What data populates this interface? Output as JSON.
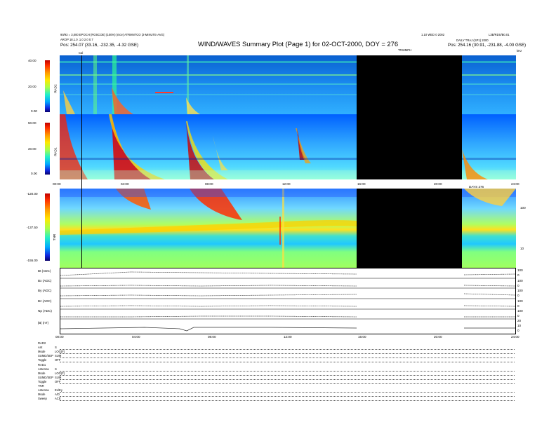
{
  "header": {
    "left_line1": "90/93 = 3,000 EPOCH (ROSCOE) (100%) (nice) ATRMNTCO (2-MINUTE-AVG)",
    "left_line2": "AROP 18.1.0 .1.0 2.0 0.7",
    "left_line3": "Pos:   254.07 (33.16, -232.35, -4.32 GSE)",
    "title": "WIND/WAVES Summary Plot (Page 1) for 02-OCT-2000, DOY = 276",
    "right_line1": "1.10 WED 0 2002",
    "right_line1b": "L3B/RDS/B0.01",
    "right_line2": "DAILY TRAJ (SP1) 2000",
    "right_line3": "Pos:   254.16 (30.91, -231.88, -4.00 GSE)",
    "center_tag": "TRIUMPH"
  },
  "cal_marker": "Cal",
  "top_right_unit": "kHz",
  "rad_unit_right": "kHz",
  "rad2": {
    "label": "RAD2",
    "ticks": [
      "40.00",
      "20.00",
      "0.00"
    ]
  },
  "rad1": {
    "label": "RAD1",
    "ticks": [
      "50.00",
      "20.00",
      "0.00"
    ]
  },
  "tnr": {
    "label": "TNR",
    "ticks": [
      "-120.00",
      "-137.50",
      "-155.00"
    ],
    "right_ticks": [
      "100",
      "10"
    ]
  },
  "time_axis": [
    "00:00",
    "04:00",
    "08:00",
    "12:00",
    "16:00",
    "20:00",
    "24:00"
  ],
  "mid_time_tag": "DAYS 276",
  "lines": [
    {
      "label": "Bt (ADC)",
      "ticks": [
        "100",
        "0"
      ]
    },
    {
      "label": "Bx (ADC)",
      "ticks": [
        "100",
        "0"
      ]
    },
    {
      "label": "By (ADC)",
      "ticks": [
        "100",
        "0"
      ]
    },
    {
      "label": "Bz (ADC)",
      "ticks": [
        "100",
        "0"
      ]
    },
    {
      "label": "Np (ADC)",
      "ticks": [
        "100",
        "0"
      ]
    },
    {
      "label": "|B| (nT)",
      "ticks": [
        "20",
        "10",
        "0"
      ]
    }
  ],
  "params": {
    "rad2_title": "RAD2",
    "rad2": [
      {
        "label": "Ant",
        "value": "S"
      },
      {
        "label": "Mode",
        "value": "LOG(F)"
      },
      {
        "label": "SUMD/SEP",
        "value": "SUM"
      },
      {
        "label": "Toggle",
        "value": "OFF"
      }
    ],
    "rad1_title": "RAD1",
    "rad1": [
      {
        "label": "Antenna",
        "value": "S"
      },
      {
        "label": "Mode",
        "value": "LOG(F)"
      },
      {
        "label": "SUMD/SEP",
        "value": "SUM"
      },
      {
        "label": "Toggle",
        "value": "OFF"
      }
    ],
    "tnr_title": "TNR",
    "tnr": [
      {
        "label": "Antenna",
        "value": "Ex/Ey"
      },
      {
        "label": "Mode",
        "value": "A/D"
      },
      {
        "label": "Sweep",
        "value": "ACE"
      }
    ]
  },
  "colors": {
    "blackout": "#000000",
    "background_blue": "#1a7fff"
  },
  "chart_data": {
    "type": "heatmap",
    "title": "WIND/WAVES Summary Plot (Page 1) for 02-OCT-2000, DOY = 276",
    "x_range_hours": [
      0,
      24
    ],
    "data_gap_hours": [
      15.8,
      21.4
    ],
    "type_iii_bursts_hours": [
      0.3,
      2.9,
      6.6,
      12.9
    ],
    "cal_marker_hour": 1.1
  }
}
